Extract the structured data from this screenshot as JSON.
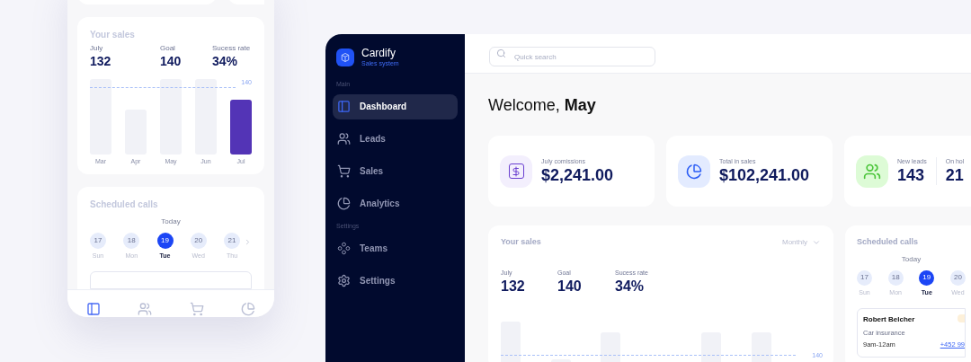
{
  "mobile": {
    "sales_card": {
      "title": "Your sales",
      "stats": [
        {
          "label": "July",
          "value": "132"
        },
        {
          "label": "Goal",
          "value": "140"
        },
        {
          "label": "Sucess rate",
          "value": "34%"
        }
      ],
      "goal_label": "140",
      "months": [
        {
          "label": "Mar",
          "selected": false
        },
        {
          "label": "Apr",
          "selected": false
        },
        {
          "label": "May",
          "selected": false
        },
        {
          "label": "Jun",
          "selected": false
        },
        {
          "label": "Jul",
          "selected": true
        }
      ]
    },
    "calls_card": {
      "title": "Scheduled calls",
      "today_label": "Today",
      "days": [
        {
          "date": "17",
          "weekday": "Sun",
          "selected": false
        },
        {
          "date": "18",
          "weekday": "Mon",
          "selected": false
        },
        {
          "date": "19",
          "weekday": "Tue",
          "selected": true
        },
        {
          "date": "20",
          "weekday": "Wed",
          "selected": false
        },
        {
          "date": "21",
          "weekday": "Thu",
          "selected": false
        }
      ]
    },
    "tab_bar": {
      "items": [
        {
          "kind": "dashboard",
          "selected": true
        },
        {
          "kind": "leads",
          "selected": false
        },
        {
          "kind": "sales",
          "selected": false
        },
        {
          "kind": "analytics",
          "selected": false
        }
      ]
    }
  },
  "desktop": {
    "brand": {
      "name": "Cardify",
      "tagline": "Sales system"
    },
    "sidebar": {
      "sections": [
        {
          "heading": "Main",
          "items": [
            {
              "kind": "dashboard",
              "label": "Dashboard",
              "selected": true
            },
            {
              "kind": "leads",
              "label": "Leads",
              "selected": false
            },
            {
              "kind": "sales",
              "label": "Sales",
              "selected": false
            },
            {
              "kind": "analytics",
              "label": "Analytics",
              "selected": false
            }
          ]
        },
        {
          "heading": "Settings",
          "items": [
            {
              "kind": "teams",
              "label": "Teams",
              "selected": false
            },
            {
              "kind": "settings",
              "label": "Settings",
              "selected": false
            }
          ]
        }
      ]
    },
    "search": {
      "placeholder": "Quick search"
    },
    "welcome": {
      "greeting": "Welcome,",
      "name": "May"
    },
    "stat_cards": [
      {
        "kind": "commissions",
        "stats": [
          {
            "label": "July comissions",
            "value": "$2,241.00"
          }
        ]
      },
      {
        "kind": "sales_total",
        "stats": [
          {
            "label": "Total in sales",
            "value": "$102,241.00"
          }
        ]
      },
      {
        "kind": "leads",
        "stats": [
          {
            "label": "New leads",
            "value": "143"
          },
          {
            "label": "On hol",
            "value": "21"
          }
        ]
      }
    ],
    "sales_card": {
      "title": "Your sales",
      "period": "Monthly",
      "stats": [
        {
          "label": "July",
          "value": "132"
        },
        {
          "label": "Goal",
          "value": "140"
        },
        {
          "label": "Sucess rate",
          "value": "34%"
        }
      ],
      "goal_label": "140"
    },
    "calls_card": {
      "title": "Scheduled calls",
      "today_label": "Today",
      "days": [
        {
          "date": "17",
          "weekday": "Sun",
          "selected": false
        },
        {
          "date": "18",
          "weekday": "Mon",
          "selected": false
        },
        {
          "date": "19",
          "weekday": "Tue",
          "selected": true
        },
        {
          "date": "20",
          "weekday": "Wed",
          "selected": false
        }
      ],
      "call": {
        "name": "Robert Belcher",
        "subject": "Car insurance",
        "time": "9am-12am",
        "phone": "+452 99"
      }
    }
  }
}
